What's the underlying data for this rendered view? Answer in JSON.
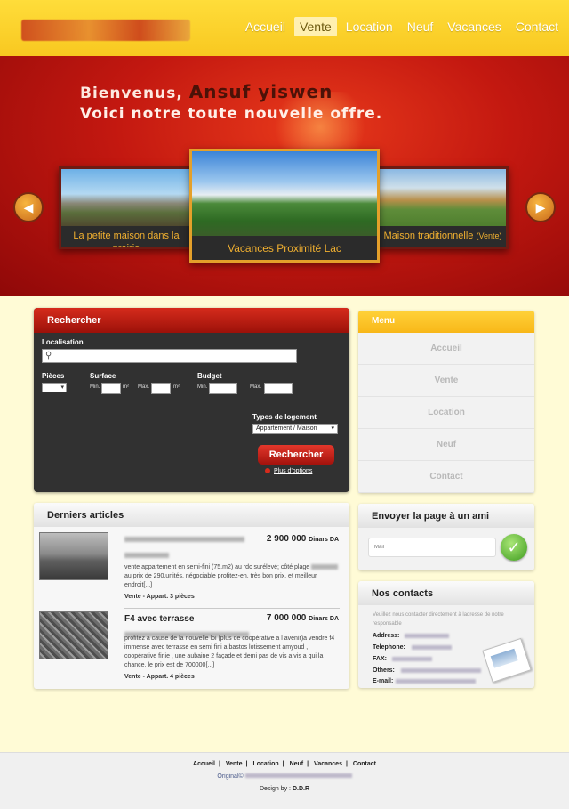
{
  "header": {
    "nav": [
      "Accueil",
      "Vente",
      "Location",
      "Neuf",
      "Vacances",
      "Contact"
    ],
    "active": "Vente"
  },
  "hero": {
    "line1_prefix": "Bienvenus,",
    "username": "Ansuf yiswen",
    "line2": "Voici notre toute nouvelle offre.",
    "slides": [
      {
        "caption": "La petite maison dans la prairie"
      },
      {
        "caption": "Vacances Proximité Lac"
      },
      {
        "caption": "Maison traditionnelle",
        "tag": "(Vente)"
      }
    ]
  },
  "search": {
    "title": "Rechercher",
    "localisation": "Localisation",
    "pieces": "Pièces",
    "surface": "Surface",
    "budget": "Budget",
    "min": "Min.",
    "max": "Max.",
    "unit": "m²",
    "types_label": "Types de logement",
    "types_value": "Appartement / Maison",
    "button": "Rechercher",
    "more": "Plus d'options"
  },
  "menu": {
    "title": "Menu",
    "items": [
      "Accueil",
      "Vente",
      "Location",
      "Neuf",
      "Contact"
    ]
  },
  "articles": {
    "title": "Derniers articles",
    "items": [
      {
        "price": "2 900 000",
        "currency": "Dinars DA",
        "desc_a": "vente appartement en semi-fini (75.m2) au rdc surélevé; côté plage",
        "desc_b": "au prix de 290.unités, négociable profitez-en, très bon prix, et meilleur endroit[...]",
        "type": "Vente - Appart. 3 pièces"
      },
      {
        "title": "F4 avec terrasse",
        "price": "7 000 000",
        "currency": "Dinars DA",
        "desc": "profitez a cause de la nouvelle loi (plus de coopérative a l avenir)a vendre f4 immense avec terrasse en semi fini a bastos lotissement amyoud , coopérative finie , une aubaine 2 façade et demi pas de vis a vis a qui la chance. le prix est de 700000[...]",
        "type": "Vente - Appart. 4 pièces"
      }
    ]
  },
  "send": {
    "title": "Envoyer la page à un ami",
    "placeholder": "Mail"
  },
  "contacts": {
    "title": "Nos contacts",
    "intro": "Veuillez nous contacter directement à ladresse de notre responsable",
    "address": "Address:",
    "telephone": "Telephone:",
    "fax": "FAX:",
    "others": "Others:",
    "email": "E-mail:"
  },
  "footer": {
    "links": [
      "Accueil",
      "Vente",
      "Location",
      "Neuf",
      "Vacances",
      "Contact"
    ],
    "copy": "Original© ",
    "design_prefix": "Design by :",
    "design_name": "D.D.R"
  },
  "colors": {
    "header": "#f8c820",
    "hero": "#c31810",
    "accent_red": "#d52b1c",
    "menu_yellow": "#ffd23a"
  }
}
